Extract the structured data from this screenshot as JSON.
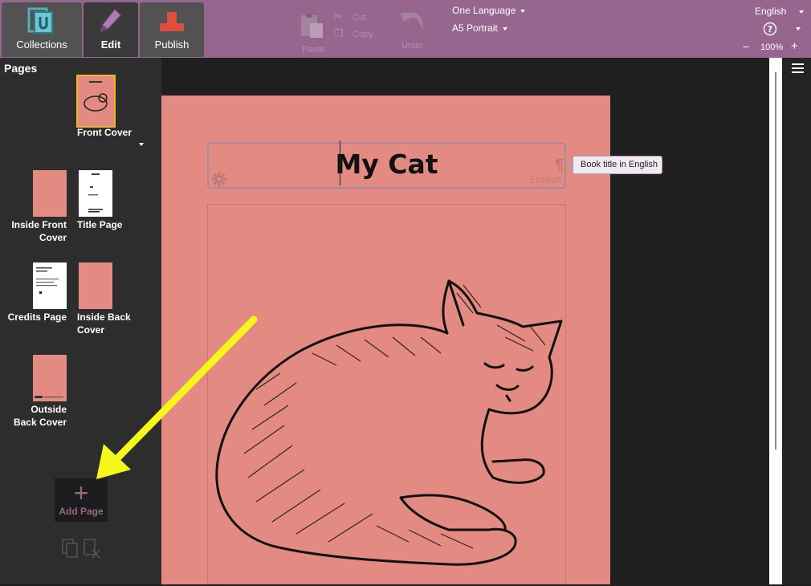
{
  "tabs": {
    "collections": "Collections",
    "edit": "Edit",
    "publish": "Publish"
  },
  "toolbar": {
    "paste": "Paste",
    "cut": "Cut",
    "copy": "Copy",
    "undo": "Undo",
    "language_mode": "One Language",
    "page_size": "A5 Portrait",
    "ui_language": "English",
    "zoom": "100%",
    "zoom_minus": "−",
    "zoom_plus": "+"
  },
  "pages_panel": {
    "title": "Pages",
    "items": [
      {
        "label": "Front Cover"
      },
      {
        "label": "Inside Front Cover"
      },
      {
        "label": "Title Page"
      },
      {
        "label": "Credits Page"
      },
      {
        "label": "Inside Back Cover"
      },
      {
        "label": "Outside Back Cover"
      }
    ],
    "add_page": "Add Page"
  },
  "editor": {
    "book_title": "My Cat",
    "title_language": "English",
    "tooltip": "Book title in English"
  },
  "colors": {
    "accent": "#96668f",
    "page": "#e38b82",
    "arrow": "#f5f71b"
  },
  "icons": [
    "collections-icon",
    "pencil-icon",
    "publish-icon",
    "paste-icon",
    "cut-icon",
    "copy-icon",
    "undo-icon",
    "help-icon",
    "gear-icon",
    "paragraph-icon",
    "hamburger-icon",
    "duplicate-page-icon",
    "delete-page-icon",
    "plus-icon"
  ]
}
